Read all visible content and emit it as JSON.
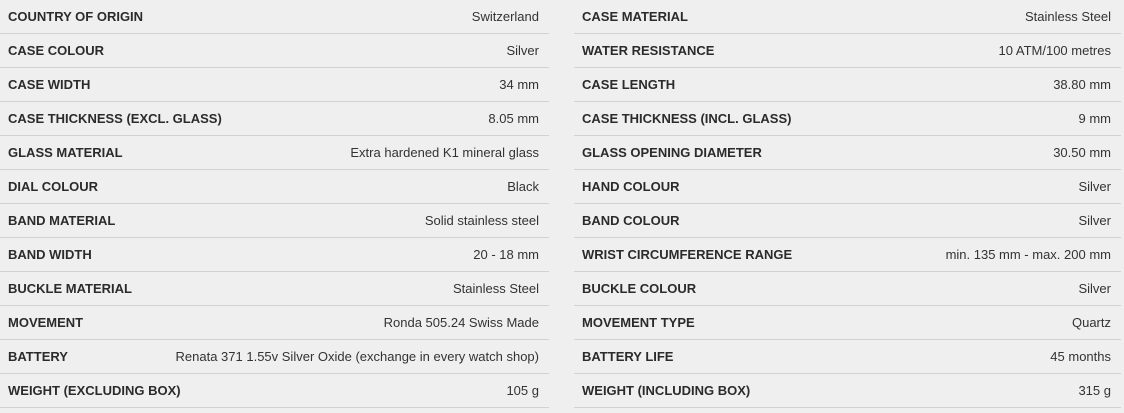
{
  "specs": {
    "left": [
      {
        "label": "COUNTRY OF ORIGIN",
        "value": "Switzerland"
      },
      {
        "label": "CASE COLOUR",
        "value": "Silver"
      },
      {
        "label": "CASE WIDTH",
        "value": "34 mm"
      },
      {
        "label": "CASE THICKNESS (EXCL. GLASS)",
        "value": "8.05 mm"
      },
      {
        "label": "GLASS MATERIAL",
        "value": "Extra hardened K1 mineral glass"
      },
      {
        "label": "DIAL COLOUR",
        "value": "Black"
      },
      {
        "label": "BAND MATERIAL",
        "value": "Solid stainless steel"
      },
      {
        "label": "BAND WIDTH",
        "value": "20 - 18 mm"
      },
      {
        "label": "BUCKLE MATERIAL",
        "value": "Stainless Steel"
      },
      {
        "label": "MOVEMENT",
        "value": "Ronda 505.24 Swiss Made"
      },
      {
        "label": "BATTERY",
        "value": "Renata 371 1.55v Silver Oxide (exchange in every watch shop)"
      },
      {
        "label": "WEIGHT (EXCLUDING BOX)",
        "value": "105 g"
      }
    ],
    "right": [
      {
        "label": "CASE MATERIAL",
        "value": "Stainless Steel"
      },
      {
        "label": "WATER RESISTANCE",
        "value": "10 ATM/100 metres"
      },
      {
        "label": "CASE LENGTH",
        "value": "38.80 mm"
      },
      {
        "label": "CASE THICKNESS (INCL. GLASS)",
        "value": "9 mm"
      },
      {
        "label": "GLASS OPENING DIAMETER",
        "value": "30.50 mm"
      },
      {
        "label": "HAND COLOUR",
        "value": "Silver"
      },
      {
        "label": "BAND COLOUR",
        "value": "Silver"
      },
      {
        "label": "WRIST CIRCUMFERENCE RANGE",
        "value": "min. 135 mm - max. 200 mm"
      },
      {
        "label": "BUCKLE COLOUR",
        "value": "Silver"
      },
      {
        "label": "MOVEMENT TYPE",
        "value": "Quartz"
      },
      {
        "label": "BATTERY LIFE",
        "value": "45 months"
      },
      {
        "label": "WEIGHT (INCLUDING BOX)",
        "value": "315 g"
      }
    ]
  }
}
